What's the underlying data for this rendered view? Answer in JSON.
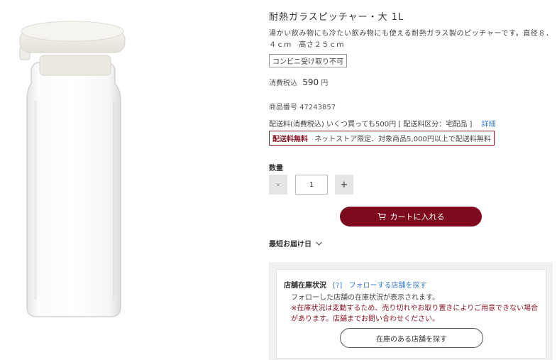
{
  "product": {
    "title": "耐熱ガラスピッチャー・大 1L",
    "description": "湯かい飲み物にも冷たい飲み物にも使える耐熱ガラス製のピッチャーです。直径８．４ｃｍ　高さ２５ｃｍ",
    "pickup_badge": "コンビニ受け取り不可",
    "price_label": "消費税込",
    "price_value": "590",
    "price_unit": "円",
    "sku_label": "商品番号",
    "sku_value": "47243857"
  },
  "shipping": {
    "text": "配送料(消費税込)  いくつ買っても500円 [ 配送料区分：宅配品 ]",
    "detail_link": "詳細",
    "free_label": "配送料無料",
    "free_text": "ネットストア限定、対象商品5,000円以上で配送料無料"
  },
  "quantity": {
    "label": "数量",
    "minus": "-",
    "value": "1",
    "plus": "+"
  },
  "cart": {
    "label": "カートに入れる",
    "icon": "cart-icon"
  },
  "delivery": {
    "label": "最短お届け日",
    "icon": "chevron-down-icon"
  },
  "stock": {
    "title": "店舗在庫状況",
    "help_link": "[?]",
    "follow_link": "フォローする店舗を探す",
    "note": "フォローした店舗の在庫状況が表示されます。",
    "warning": "※在庫状況は変動するため、売り切れやお取り置きによりご用意できない場合があります。店舗までお問い合わせください。",
    "find_button": "在庫のある店舗を探す"
  },
  "colors": {
    "brand": "#7d0a1e",
    "link": "#3b7bd4",
    "panel_bg": "#f0f0f0"
  }
}
